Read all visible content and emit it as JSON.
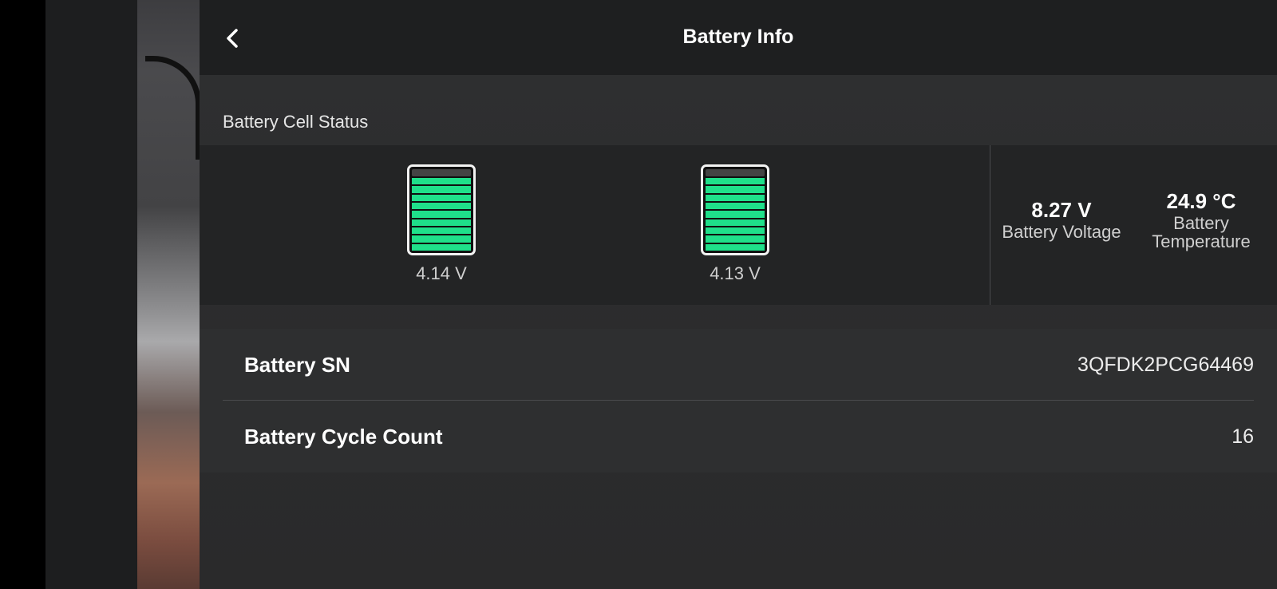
{
  "header": {
    "back_icon": "chevron-left-icon",
    "title": "Battery Info"
  },
  "cell_status": {
    "label": "Battery Cell Status",
    "cells": [
      {
        "voltage": "4.14 V",
        "fill_level": 1.0,
        "color": "#1fe08a"
      },
      {
        "voltage": "4.13 V",
        "fill_level": 1.0,
        "color": "#1fe08a"
      }
    ],
    "voltage": {
      "value": "8.27 V",
      "label": "Battery Voltage"
    },
    "temperature": {
      "value": "24.9 °C",
      "label": "Battery Temperature"
    }
  },
  "info_rows": [
    {
      "label": "Battery SN",
      "value": "3QFDK2PCG64469"
    },
    {
      "label": "Battery Cycle Count",
      "value": "16"
    }
  ]
}
